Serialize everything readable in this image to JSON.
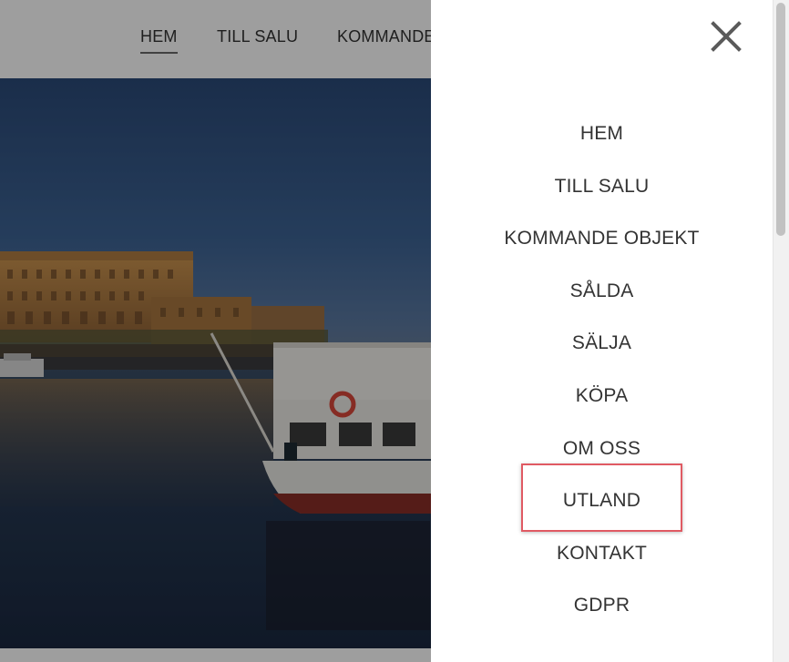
{
  "top_nav": {
    "items": [
      {
        "label": "HEM",
        "active": true
      },
      {
        "label": "TILL SALU",
        "active": false
      },
      {
        "label": "KOMMANDE",
        "active": false
      }
    ]
  },
  "side_menu": {
    "close_icon": "close-icon",
    "items": [
      {
        "label": "HEM"
      },
      {
        "label": "TILL SALU"
      },
      {
        "label": "KOMMANDE OBJEKT"
      },
      {
        "label": "SÅLDA"
      },
      {
        "label": "SÄLJA"
      },
      {
        "label": "KÖPA"
      },
      {
        "label": "OM OSS"
      },
      {
        "label": "UTLAND",
        "highlighted": true
      },
      {
        "label": "KONTAKT"
      },
      {
        "label": "GDPR"
      }
    ]
  },
  "colors": {
    "text": "#333333",
    "highlight_border": "#e05a63",
    "overlay": "rgba(0,0,0,0.38)",
    "menu_bg": "#ffffff"
  }
}
